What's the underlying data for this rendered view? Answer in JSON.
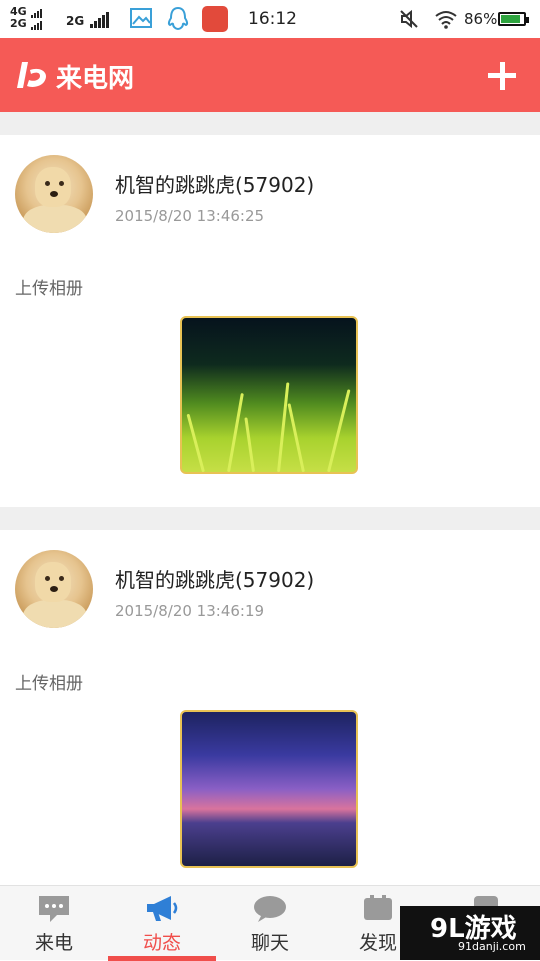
{
  "status_bar": {
    "network1": "4G",
    "network2": "2G",
    "network3": "2G",
    "time": "16:12",
    "battery": "86%",
    "icons": [
      "signal-icon",
      "gallery-icon",
      "qq-icon",
      "app-icon",
      "mute-icon",
      "wifi-icon",
      "battery-icon"
    ]
  },
  "header": {
    "title": "来电网",
    "brand_color": "#f55a56",
    "logo_icon": "laidian-logo-icon",
    "add_icon": "plus-icon"
  },
  "posts": [
    {
      "username": "机智的跳跳虎(57902)",
      "time": "2015/8/20 13:46:25",
      "action": "上传相册",
      "image_icon": "grass-photo"
    },
    {
      "username": "机智的跳跳虎(57902)",
      "time": "2015/8/20 13:46:19",
      "action": "上传相册",
      "image_icon": "sunset-sky-photo"
    }
  ],
  "bottom_nav": {
    "active_color": "#f04e4b",
    "items": [
      {
        "label": "来电",
        "icon": "chat-bubble-icon"
      },
      {
        "label": "动态",
        "icon": "megaphone-icon"
      },
      {
        "label": "聊天",
        "icon": "speech-bubble-icon"
      },
      {
        "label": "发现",
        "icon": "discover-icon"
      },
      {
        "label": "",
        "icon": "profile-icon"
      }
    ]
  },
  "watermark": {
    "main": "9L游戏",
    "sub": "91danji.com"
  }
}
